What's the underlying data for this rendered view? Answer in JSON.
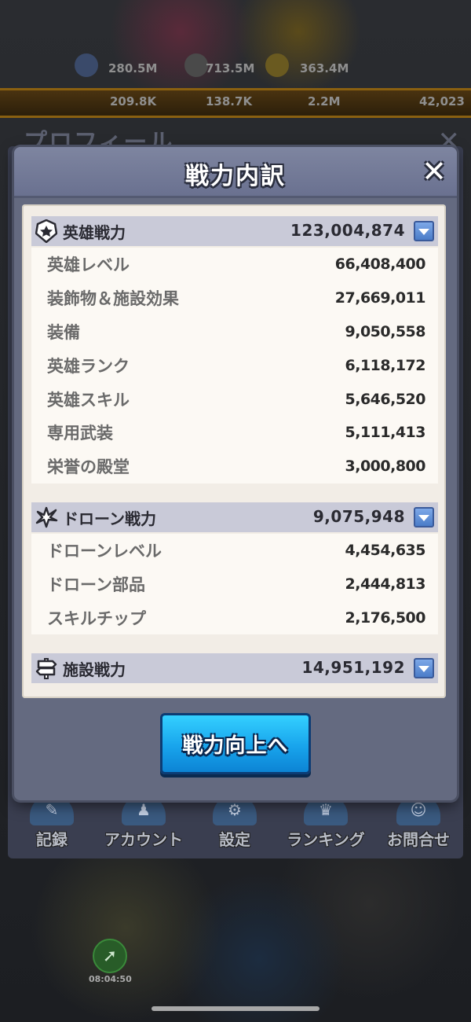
{
  "background": {
    "resources_row1": [
      "280.5M",
      "713.5M",
      "363.4M"
    ],
    "resources_row2": [
      "209.8K",
      "138.7K",
      "2.2M",
      "42,023"
    ],
    "behind_title": "プロフィール",
    "behind_close": "✕",
    "bottom_nav": [
      {
        "label": "記録",
        "icon": "record-icon"
      },
      {
        "label": "アカウント",
        "icon": "account-icon"
      },
      {
        "label": "設定",
        "icon": "gear-icon"
      },
      {
        "label": "ランキング",
        "icon": "trophy-icon"
      },
      {
        "label": "お問合せ",
        "icon": "support-icon"
      }
    ],
    "timer": "08:04:50"
  },
  "modal": {
    "title": "戦力内訳",
    "close_label": "✕",
    "sections": [
      {
        "title": "英雄戦力",
        "icon": "hero-badge-icon",
        "total": "123,004,874",
        "rows": [
          {
            "label": "英雄レベル",
            "value": "66,408,400"
          },
          {
            "label": "装飾物＆施設効果",
            "value": "27,669,011"
          },
          {
            "label": "装備",
            "value": "9,050,558"
          },
          {
            "label": "英雄ランク",
            "value": "6,118,172"
          },
          {
            "label": "英雄スキル",
            "value": "5,646,520"
          },
          {
            "label": "専用武装",
            "value": "5,111,413"
          },
          {
            "label": "栄誉の殿堂",
            "value": "3,000,800"
          }
        ]
      },
      {
        "title": "ドローン戦力",
        "icon": "drone-icon",
        "total": "9,075,948",
        "rows": [
          {
            "label": "ドローンレベル",
            "value": "4,454,635"
          },
          {
            "label": "ドローン部品",
            "value": "2,444,813"
          },
          {
            "label": "スキルチップ",
            "value": "2,176,500"
          }
        ]
      },
      {
        "title": "施設戦力",
        "icon": "signpost-icon",
        "total": "14,951,192",
        "rows": []
      }
    ],
    "action_button": "戦力向上へ"
  }
}
